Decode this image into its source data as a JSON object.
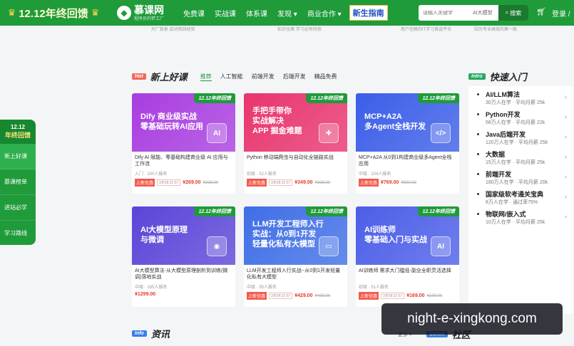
{
  "header": {
    "promo": "12.12年终回馈",
    "logo_name": "慕课网",
    "logo_slogan": "程序员的梦工厂",
    "nav": [
      "免费课",
      "实战课",
      "体系课",
      "发现 ▾",
      "商业合作 ▾"
    ],
    "newbie": "新生指南",
    "search_placeholder": "请输入关键字",
    "search_tag": "AI大模型",
    "search_button": "搜索",
    "login": "登录 /"
  },
  "strip": [
    "大厂背景 成功简目经验",
    "知识全面 学习必有所获",
    "用户信赖的IT学习首选平台",
    "因为专业高效的第一般"
  ],
  "sidebar": {
    "head_top": "12.12",
    "head_main": "年终回馈",
    "items": [
      "新上好课",
      "慕课榜单",
      "进站必学",
      "学习路线"
    ]
  },
  "new_section": {
    "badge": "Hot",
    "title": "新上好课",
    "tabs": [
      "推荐",
      "人工智能",
      "前端开发",
      "后端开发",
      "精品免费"
    ]
  },
  "colors": {
    "green": "#1f9b3a",
    "c1": "#a83de0",
    "c2": "#e8356e",
    "c3": "#3b5ee8",
    "c4": "#5a45d8",
    "c5": "#3f6ee6",
    "c6": "#4c5ee8"
  },
  "cards": [
    {
      "ribbon": "12.12年终回馈",
      "banner": [
        "Dify 商业级实战",
        "零基础玩转AI应用"
      ],
      "icon": "AI",
      "title": "Dify AI 賦能、零基础构建商业级 AI 应用与工作流",
      "meta": "入门 · 100人报名",
      "tag": "上新优惠",
      "tag2": "3天08:22:57",
      "price": "¥269.00",
      "orig": "¥299.00"
    },
    {
      "ribbon": "12.12年终回馈",
      "banner": [
        "手把手带你",
        "实战解决",
        "APP 掘金难题"
      ],
      "icon": "✚",
      "title": "Python 移动端爬虫与自动化全链路实战",
      "meta": "初级 · 52人报名",
      "tag": "上新优惠",
      "tag2": "3天08:22:57",
      "price": "¥349.00",
      "orig": "¥399.00"
    },
    {
      "ribbon": "12.12年终回馈",
      "banner": [
        "MCP+A2A",
        "多Agent全栈开发"
      ],
      "icon": "</>",
      "title": "MCP+A2A 从0到1构建商业级多Agent全栈应用",
      "meta": "中级 · 204人报名",
      "tag": "上新优惠",
      "tag2": "",
      "price": "¥769.00",
      "orig": "¥900.00"
    },
    {
      "ribbon": "12.12年终回馈",
      "banner": [
        "AI大模型原理",
        "与微调"
      ],
      "icon": "◉",
      "title": "AI大模型算法-从大模型原理剖析到训练(微调)落地实战",
      "meta": "中级 · 185人报名",
      "tag": "",
      "tag2": "",
      "price": "¥1299.00",
      "orig": ""
    },
    {
      "ribbon": "12.12年终回馈",
      "banner": [
        "LLM开发工程师入行",
        "实战：从0到1开发",
        "轻量化私有大模型"
      ],
      "icon": "▭",
      "title": "LLM开发工程师入行实战--从0到1开发轻量化私有大模型",
      "meta": "中级 · 95人报名",
      "tag": "上新优惠",
      "tag2": "3天08:22:57",
      "price": "¥429.00",
      "orig": "¥499.00"
    },
    {
      "ribbon": "12.12年终回馈",
      "banner": [
        "AI训练师",
        "零基础入门与实战"
      ],
      "icon": "AI",
      "title": "AI训练师 需求大门槛低-副业全职灵活选择",
      "meta": "初级 · 51人报名",
      "tag": "上新优惠",
      "tag2": "3天08:22:57",
      "price": "¥169.00",
      "orig": "¥199.00"
    }
  ],
  "fast_section": {
    "badge": "Intro",
    "title": "快速入门",
    "items": [
      {
        "t": "AI/LLM算法",
        "s": "30万人在学 · 平均月薪 25k"
      },
      {
        "t": "Python开发",
        "s": "58万人在学 · 平均月薪 22k"
      },
      {
        "t": "Java后端开发",
        "s": "120万人在学 · 平均月薪 25k"
      },
      {
        "t": "大数据",
        "s": "15万人在学 · 平均月薪 25k"
      },
      {
        "t": "前端开发",
        "s": "180万人在学 · 平均月薪 20k"
      },
      {
        "t": "国家级软考通关宝典",
        "s": "8万人在学 · 通过率75%"
      },
      {
        "t": "物联网/嵌入式",
        "s": "10万人在学 · 平均月薪 25k"
      }
    ]
  },
  "info_section": {
    "badge": "Info",
    "title": "资讯",
    "more": "更多 >",
    "comm_badge": "Comm",
    "comm_title": "社区"
  },
  "watermark": "night-e-xingkong.com"
}
